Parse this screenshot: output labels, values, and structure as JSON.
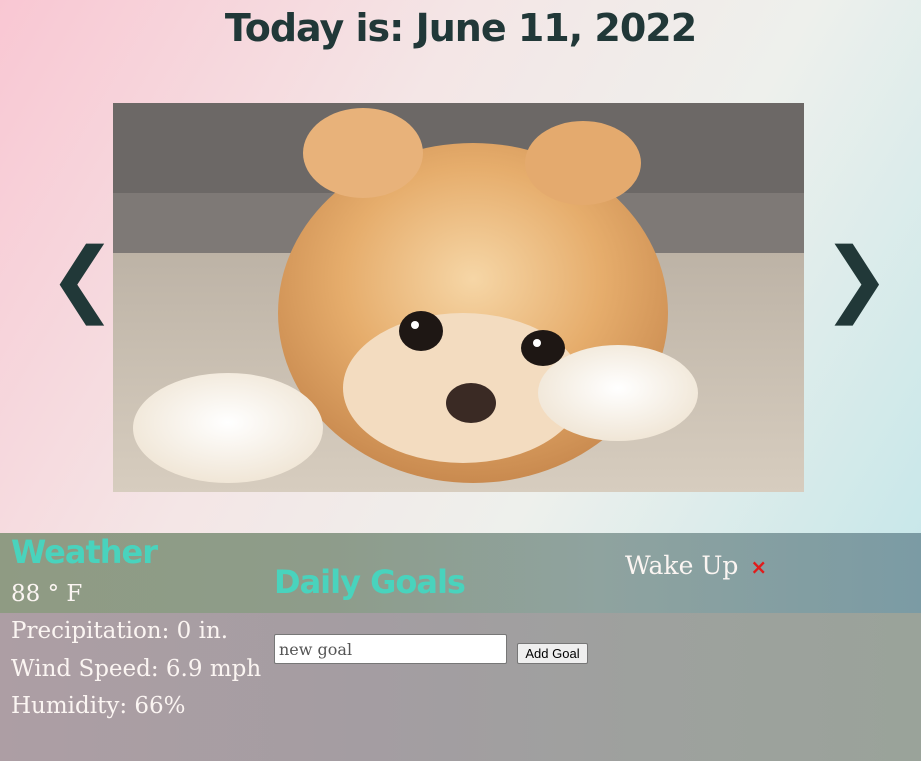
{
  "header": {
    "title": "Today is: June 11, 2022"
  },
  "carousel": {
    "prev_arrow": "❮",
    "next_arrow": "❯"
  },
  "weather": {
    "heading": "Weather",
    "temperature": "88 ° F",
    "precipitation": "Precipitation: 0 in.",
    "wind_speed": "Wind Speed: 6.9 mph",
    "humidity": "Humidity: 66%"
  },
  "goals": {
    "heading": "Daily Goals",
    "input_placeholder": "new goal",
    "add_button_label": "Add Goal",
    "items": [
      {
        "label": "Wake Up",
        "delete_icon": "×"
      }
    ]
  },
  "colors": {
    "title": "#213838",
    "heading_accent": "#49d3bd",
    "delete_red": "#e11b1b"
  }
}
